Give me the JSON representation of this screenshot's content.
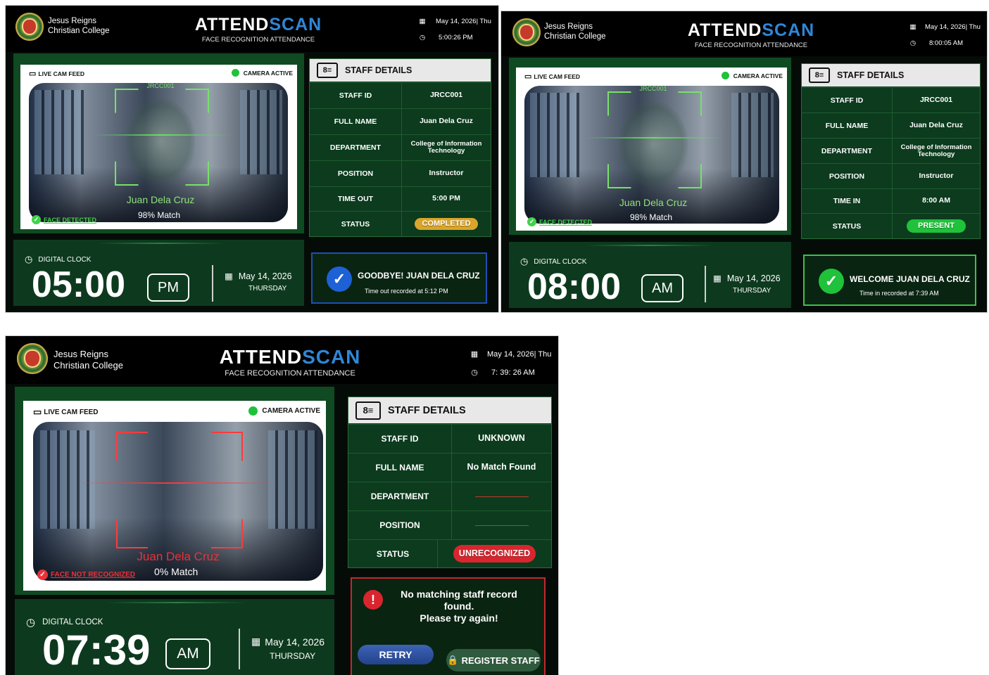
{
  "colors": {
    "brand_blue": "#2f86d6",
    "panel_green": "#0c3b1e",
    "success": "#1fc23a",
    "completed": "#d9a52b",
    "error": "#d9262e"
  },
  "screens": [
    {
      "school": {
        "line1": "Jesus Reigns",
        "line2": "Christian College"
      },
      "brand": {
        "part1": "ATTEND",
        "part2": "SCAN",
        "subtitle": "FACE RECOGNITION ATTENDANCE"
      },
      "header": {
        "date": "May 14, 2026| Thu",
        "time": "5:00:26 PM",
        "calendar_icon": "calendar-icon",
        "clock_icon": "clock-icon"
      },
      "camera": {
        "feed_label": "LIVE CAM FEED",
        "status": "CAMERA ACTIVE",
        "tag": "JRCC001",
        "name": "Juan Dela Cruz",
        "match": "98% Match",
        "detect_text": "FACE DETECTED"
      },
      "details": {
        "title": "STAFF DETAILS",
        "rows": [
          {
            "label": "STAFF ID",
            "value": "JRCC001"
          },
          {
            "label": "FULL NAME",
            "value": "Juan Dela Cruz"
          },
          {
            "label": "DEPARTMENT",
            "value": "College of Information Technology"
          },
          {
            "label": "POSITION",
            "value": "Instructor"
          },
          {
            "label": "TIME OUT",
            "value": "5:00 PM"
          },
          {
            "label": "STATUS",
            "value": "COMPLETED"
          }
        ]
      },
      "clock": {
        "label": "DIGITAL CLOCK",
        "time": "05:00",
        "ampm": "PM",
        "date": "May 14, 2026",
        "day": "THURSDAY"
      },
      "message": {
        "title": "GOODBYE! JUAN DELA CRUZ",
        "subtitle": "Time out  recorded at 5:12 PM"
      }
    },
    {
      "school": {
        "line1": "Jesus Reigns",
        "line2": "Christian College"
      },
      "brand": {
        "part1": "ATTEND",
        "part2": "SCAN",
        "subtitle": "FACE RECOGNITION  ATTENDANCE"
      },
      "header": {
        "date": "May 14, 2026| Thu",
        "time": "8:00:05 AM",
        "calendar_icon": "calendar-icon",
        "clock_icon": "clock-icon"
      },
      "camera": {
        "feed_label": "LIVE CAM FEED",
        "status": "CAMERA ACTIVE",
        "tag": "JRCC001",
        "name": "Juan Dela Cruz",
        "match": "98% Match",
        "detect_text": "FACE DETECTED"
      },
      "details": {
        "title": "STAFF DETAILS",
        "rows": [
          {
            "label": "STAFF ID",
            "value": "JRCC001"
          },
          {
            "label": "FULL NAME",
            "value": "Juan Dela Cruz"
          },
          {
            "label": "DEPARTMENT",
            "value": "College of Information Technology"
          },
          {
            "label": "POSITION",
            "value": "Instructor"
          },
          {
            "label": "TIME IN",
            "value": "8:00 AM"
          },
          {
            "label": "STATUS",
            "value": "PRESENT"
          }
        ]
      },
      "clock": {
        "label": "DIGITAL CLOCK",
        "time": "08:00",
        "ampm": "AM",
        "date": "May 14, 2026",
        "day": "THURSDAY"
      },
      "message": {
        "title": "WELCOME JUAN DELA CRUZ",
        "subtitle": "Time in recorded at 7:39 AM"
      }
    },
    {
      "school": {
        "line1": "Jesus Reigns",
        "line2": "Christian College"
      },
      "brand": {
        "part1": "ATTEND",
        "part2": "SCAN",
        "subtitle": "FACE RECOGNITION ATTENDANCE"
      },
      "header": {
        "date": "May 14, 2026| Thu",
        "time": "7: 39: 26 AM",
        "calendar_icon": "calendar-icon",
        "clock_icon": "clock-icon"
      },
      "camera": {
        "feed_label": "LIVE CAM FEED",
        "status": "CAMERA ACTIVE",
        "name": "Juan Dela Cruz",
        "match": "0% Match",
        "detect_text": "FACE NOT RECOGNIZED"
      },
      "details": {
        "title": "STAFF DETAILS",
        "rows": [
          {
            "label": "STAFF ID",
            "value": "UNKNOWN"
          },
          {
            "label": "FULL NAME",
            "value": "No Match Found"
          },
          {
            "label": "DEPARTMENT",
            "value": ""
          },
          {
            "label": "POSITION",
            "value": ""
          },
          {
            "label": "STATUS",
            "value": "UNRECOGNIZED"
          }
        ]
      },
      "clock": {
        "label": "DIGITAL CLOCK",
        "time": "07:39",
        "ampm": "AM",
        "date": "May 14, 2026",
        "day": "THURSDAY"
      },
      "message": {
        "line1": "No matching staff record",
        "line2": "found.",
        "line3": "Please try again!",
        "retry": "RETRY",
        "register": "REGISTER STAFF"
      }
    }
  ]
}
